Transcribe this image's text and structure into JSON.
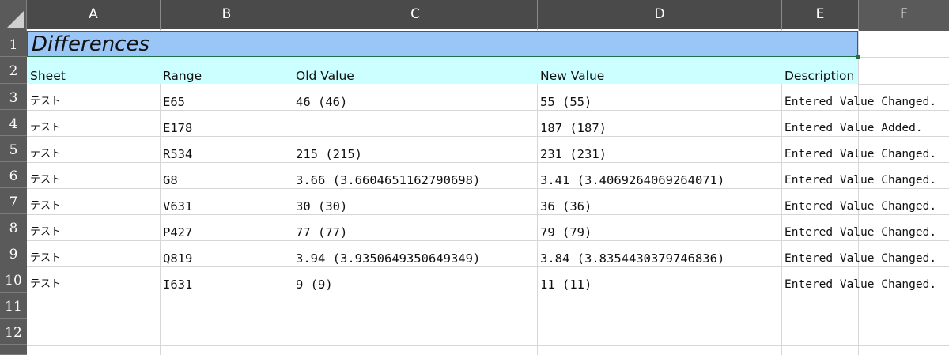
{
  "columns": [
    "A",
    "B",
    "C",
    "D",
    "E",
    "F"
  ],
  "row_numbers": [
    "1",
    "2",
    "3",
    "4",
    "5",
    "6",
    "7",
    "8",
    "9",
    "10",
    "11",
    "12"
  ],
  "title": "Differences",
  "headers": {
    "sheet": "Sheet",
    "range": "Range",
    "old_value": "Old Value",
    "new_value": "New Value",
    "description": "Description"
  },
  "rows": [
    {
      "sheet": "テスト",
      "range": "E65",
      "old_value": "46 (46)",
      "new_value": "55 (55)",
      "description": "Entered Value Changed."
    },
    {
      "sheet": "テスト",
      "range": "E178",
      "old_value": "",
      "new_value": "187 (187)",
      "description": "Entered Value Added."
    },
    {
      "sheet": "テスト",
      "range": "R534",
      "old_value": "215 (215)",
      "new_value": "231 (231)",
      "description": "Entered Value Changed."
    },
    {
      "sheet": "テスト",
      "range": "G8",
      "old_value": "3.66 (3.6604651162790698)",
      "new_value": "3.41 (3.4069264069264071)",
      "description": "Entered Value Changed."
    },
    {
      "sheet": "テスト",
      "range": "V631",
      "old_value": "30 (30)",
      "new_value": "36 (36)",
      "description": "Entered Value Changed."
    },
    {
      "sheet": "テスト",
      "range": "P427",
      "old_value": "77 (77)",
      "new_value": "79 (79)",
      "description": "Entered Value Changed."
    },
    {
      "sheet": "テスト",
      "range": "Q819",
      "old_value": "3.94 (3.9350649350649349)",
      "new_value": "3.84 (3.8354430379746836)",
      "description": "Entered Value Changed."
    },
    {
      "sheet": "テスト",
      "range": "I631",
      "old_value": "9 (9)",
      "new_value": "11 (11)",
      "description": "Entered Value Changed."
    }
  ],
  "colors": {
    "title_fill": "#99c6f7",
    "header_fill": "#ccffff",
    "selection_border": "#1e7145",
    "chrome": "#5a5a5a"
  }
}
